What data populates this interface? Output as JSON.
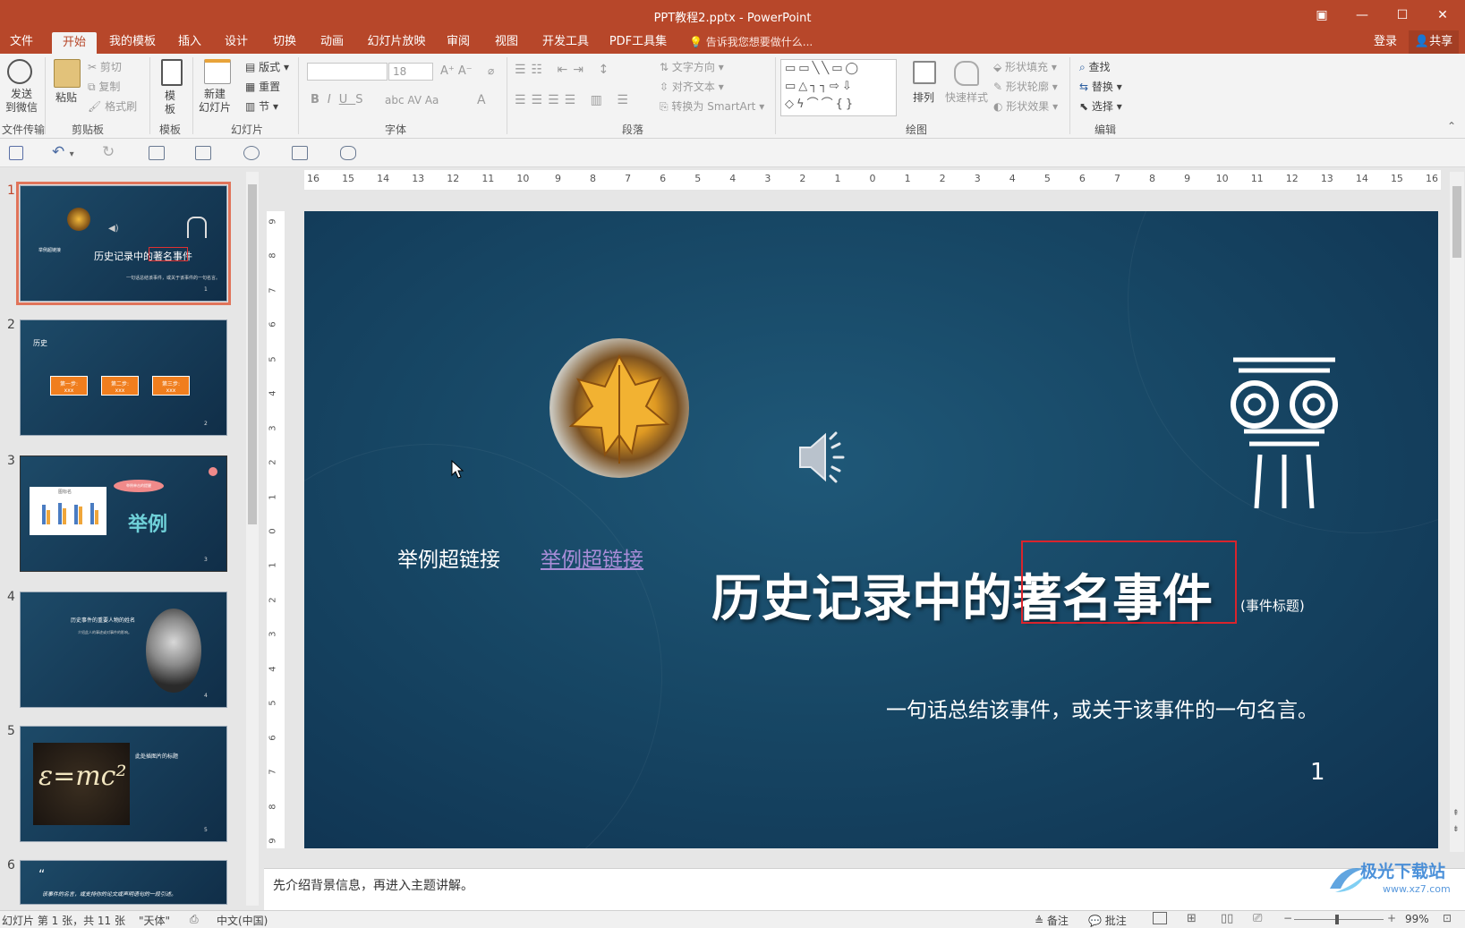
{
  "window": {
    "title": "PPT教程2.pptx - PowerPoint"
  },
  "menu": {
    "tabs": [
      "文件",
      "开始",
      "我的模板",
      "插入",
      "设计",
      "切换",
      "动画",
      "幻灯片放映",
      "审阅",
      "视图",
      "开发工具",
      "PDF工具集"
    ],
    "tell_me": "告诉我您想要做什么...",
    "login": "登录",
    "share": "共享"
  },
  "ribbon": {
    "send_wechat": "发送\n到微信",
    "file_transfer": "文件传输",
    "paste": "粘贴",
    "cut": "剪切",
    "copy": "复制",
    "format_painter": "格式刷",
    "clipboard": "剪贴板",
    "template_btn": "模\n板",
    "template_group": "模板",
    "new_slide": "新建\n幻灯片",
    "layout": "版式",
    "reset": "重置",
    "section": "节",
    "slides_group": "幻灯片",
    "font_size": "18",
    "font_group": "字体",
    "text_direction": "文字方向",
    "align_text": "对齐文本",
    "convert_smartart": "转换为 SmartArt",
    "paragraph_group": "段落",
    "arrange": "排列",
    "quick_styles": "快速样式",
    "shape_fill": "形状填充",
    "shape_outline": "形状轮廓",
    "shape_effects": "形状效果",
    "drawing_group": "绘图",
    "find": "查找",
    "replace": "替换",
    "select": "选择",
    "editing_group": "编辑"
  },
  "ruler": {
    "h_ticks": [
      "16",
      "15",
      "14",
      "13",
      "12",
      "11",
      "10",
      "9",
      "8",
      "7",
      "6",
      "5",
      "4",
      "3",
      "2",
      "1",
      "0",
      "1",
      "2",
      "3",
      "4",
      "5",
      "6",
      "7",
      "8",
      "9",
      "10",
      "11",
      "12",
      "13",
      "14",
      "15",
      "16"
    ],
    "v_ticks": [
      "9",
      "8",
      "7",
      "6",
      "5",
      "4",
      "3",
      "2",
      "1",
      "0",
      "1",
      "2",
      "3",
      "4",
      "5",
      "6",
      "7",
      "8",
      "9"
    ]
  },
  "thumbnails": [
    {
      "num": "1",
      "title": "历史记录中的著名事件",
      "sub": "一句话总结该事件，或关于该事件的一句名言。",
      "link_left": "举例超链接",
      "page": "1"
    },
    {
      "num": "2",
      "title": "历史",
      "steps": [
        "第一步:",
        "第二步:",
        "第三步:"
      ],
      "step_sub": "xxx",
      "page": "2"
    },
    {
      "num": "3",
      "title": "举例",
      "chart_title": "图标名",
      "bubble": "举例单击的提醒",
      "page": "3"
    },
    {
      "num": "4",
      "title": "历史事件的重要人物的姓名",
      "sub": "介绍此人的事迹或对事件的影响。",
      "page": "4"
    },
    {
      "num": "5",
      "title": "此处插图片的标题",
      "formula": "ε=mc²",
      "page": "5"
    },
    {
      "num": "6",
      "quote": "该事件的名言，或支持你的论文或声明语句的一段引述。"
    }
  ],
  "slide": {
    "link_plain": "举例超链接",
    "link_hyper": "举例超链接",
    "title_prefix": "历史记录中的",
    "title_selected": "著名事件",
    "title_note": "(事件标题)",
    "subtitle": "一句话总结该事件，或关于该事件的一句名言。",
    "page_number": "1"
  },
  "notes": {
    "text": "先介绍背景信息，再进入主题讲解。"
  },
  "status": {
    "slide_info": "幻灯片 第 1 张，共 11 张",
    "theme": "\"天体\"",
    "language": "中文(中国)",
    "notes_btn": "备注",
    "comments_btn": "批注",
    "zoom": "99%"
  },
  "watermark": {
    "text": "极光下载站",
    "url": "www.xz7.com"
  },
  "colors": {
    "accent": "#b7472a",
    "slide_bg": "#174765",
    "selection": "#d9242c",
    "hyperlink": "#a98dd8"
  }
}
